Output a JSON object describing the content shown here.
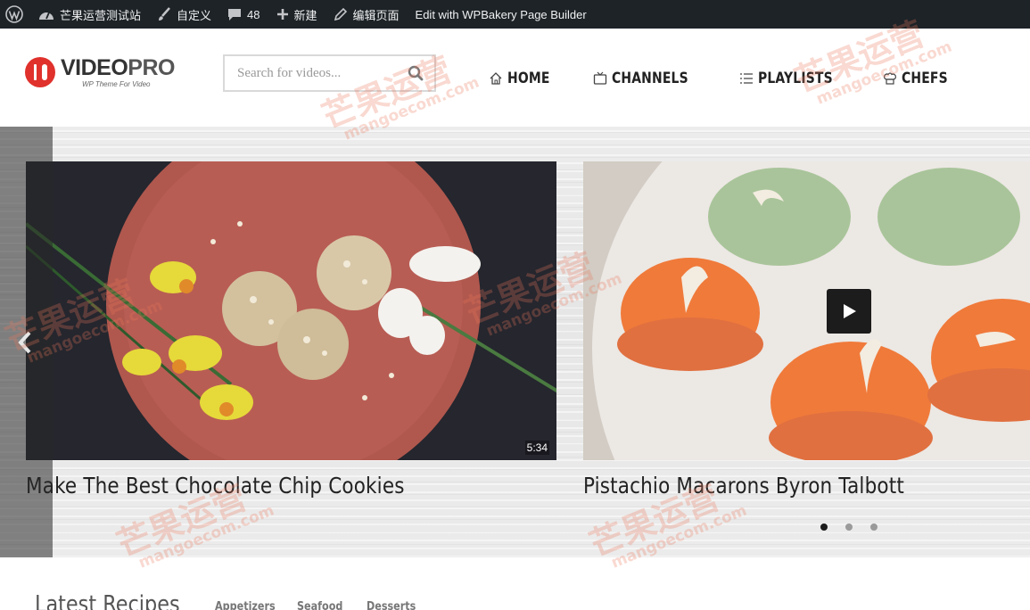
{
  "adminbar": {
    "site_name": "芒果运营测试站",
    "customize": "自定义",
    "comments_count": "48",
    "new": "新建",
    "edit_page": "编辑页面",
    "wpbakery": "Edit with WPBakery Page Builder"
  },
  "header": {
    "logo_word_a": "VIDEO",
    "logo_word_b": "PRO",
    "logo_tagline": "WP Theme For Video",
    "search_placeholder": "Search for videos...",
    "nav": [
      {
        "label": "HOME",
        "icon": "home-icon"
      },
      {
        "label": "CHANNELS",
        "icon": "tv-icon"
      },
      {
        "label": "PLAYLISTS",
        "icon": "list-icon"
      },
      {
        "label": "CHEFS",
        "icon": "chef-hat-icon"
      }
    ]
  },
  "slider": {
    "slides": [
      {
        "title": "Make The Best Chocolate Chip Cookies",
        "duration": "5:34"
      },
      {
        "title": "Pistachio Macarons Byron Talbott"
      }
    ],
    "dots_count": 3,
    "active_dot": 1
  },
  "latest": {
    "title": "Latest Recipes",
    "tabs": [
      "Appetizers",
      "Seafood",
      "Desserts"
    ]
  },
  "watermark": {
    "text": "芒果运营",
    "subtext": "mangoecom.com"
  },
  "colors": {
    "adminbar_bg": "#1d2327",
    "logo_red": "#e0312c",
    "text_dark": "#222222",
    "active_dot": "#1c1c1c"
  }
}
